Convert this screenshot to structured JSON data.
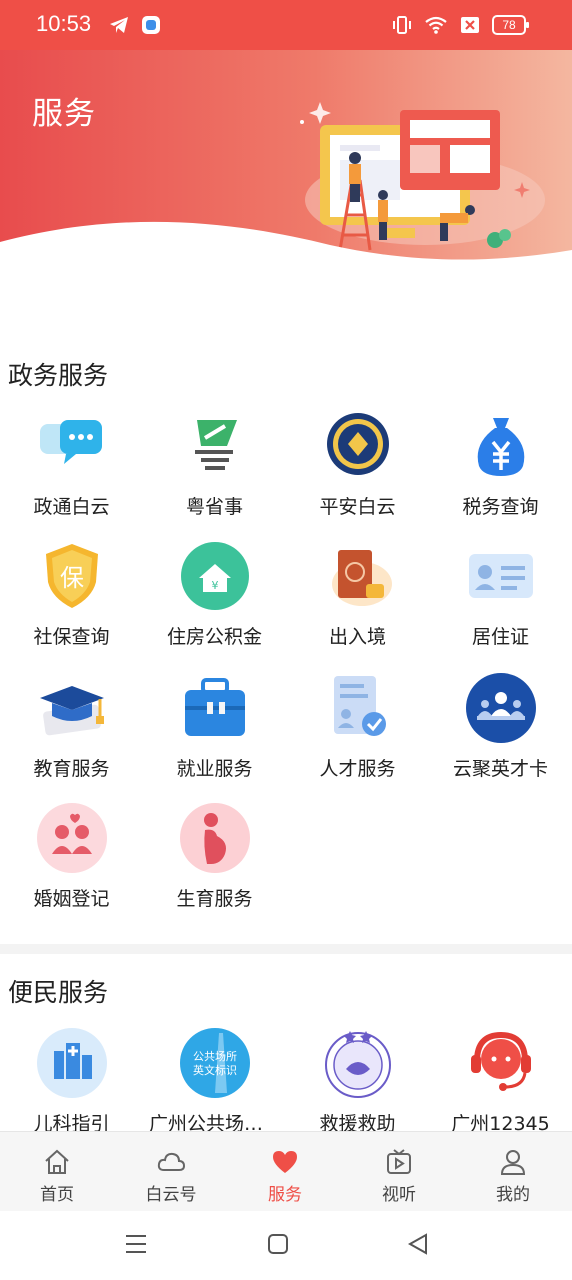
{
  "status": {
    "time": "10:53",
    "battery": "78"
  },
  "header": {
    "title": "服务"
  },
  "gov": {
    "title": "政务服务",
    "items": [
      {
        "label": "政通白云",
        "icon": "chat-bubbles-icon"
      },
      {
        "label": "粤省事",
        "icon": "yueshengshi-logo-icon"
      },
      {
        "label": "平安白云",
        "icon": "police-badge-icon"
      },
      {
        "label": "税务查询",
        "icon": "money-bag-icon"
      },
      {
        "label": "社保查询",
        "icon": "social-security-shield-icon"
      },
      {
        "label": "住房公积金",
        "icon": "house-fund-icon"
      },
      {
        "label": "出入境",
        "icon": "passport-icon"
      },
      {
        "label": "居住证",
        "icon": "id-card-icon"
      },
      {
        "label": "教育服务",
        "icon": "graduation-cap-icon"
      },
      {
        "label": "就业服务",
        "icon": "briefcase-icon"
      },
      {
        "label": "人才服务",
        "icon": "talent-document-icon"
      },
      {
        "label": "云聚英才卡",
        "icon": "people-group-icon"
      },
      {
        "label": "婚姻登记",
        "icon": "couple-icon"
      },
      {
        "label": "生育服务",
        "icon": "pregnancy-icon"
      }
    ]
  },
  "convenience": {
    "title": "便民服务",
    "items": [
      {
        "label": "儿科指引",
        "icon": "hospital-icon"
      },
      {
        "label": "广州公共场所…",
        "icon": "public-place-sign-icon",
        "icon_text": "公共场所英文标识"
      },
      {
        "label": "救援救助",
        "icon": "rescue-seal-icon"
      },
      {
        "label": "广州12345",
        "icon": "hotline-headset-icon"
      }
    ]
  },
  "tabbar": {
    "items": [
      {
        "label": "首页",
        "icon": "home-icon"
      },
      {
        "label": "白云号",
        "icon": "cloud-icon"
      },
      {
        "label": "服务",
        "icon": "heart-icon",
        "active": true
      },
      {
        "label": "视听",
        "icon": "tv-play-icon"
      },
      {
        "label": "我的",
        "icon": "user-icon"
      }
    ]
  },
  "colors": {
    "accent": "#ef4f47",
    "banner_start": "#e84c4d",
    "banner_end": "#f4b7a0"
  }
}
